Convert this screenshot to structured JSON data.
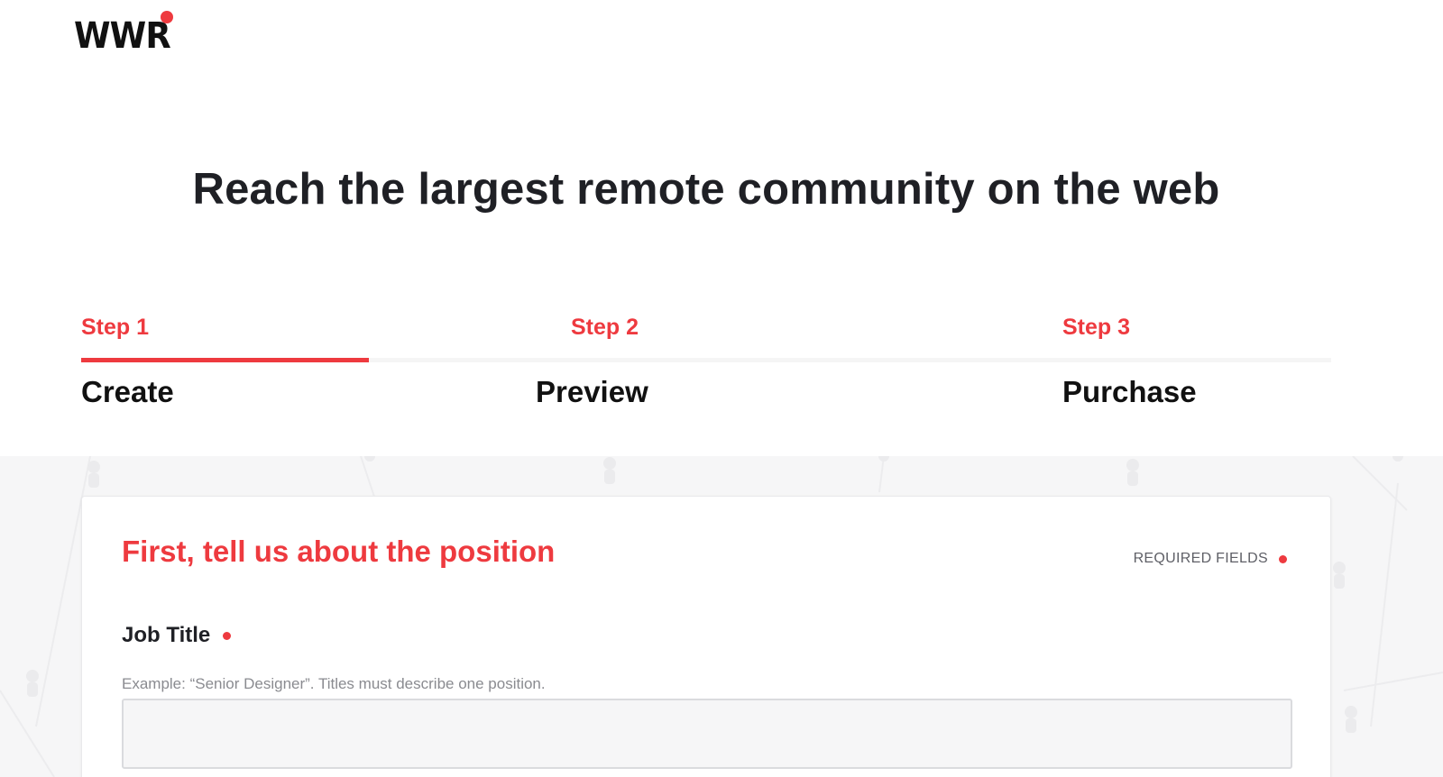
{
  "brand": {
    "logo_text": "WWR",
    "accent": "#ee3a3f"
  },
  "hero": {
    "title": "Reach the largest remote community on the web"
  },
  "steps": [
    {
      "label": "Step 1",
      "name": "Create",
      "active": true
    },
    {
      "label": "Step 2",
      "name": "Preview",
      "active": false
    },
    {
      "label": "Step 3",
      "name": "Purchase",
      "active": false
    }
  ],
  "progress": {
    "fraction": 0.23
  },
  "form": {
    "section_title": "First, tell us about the position",
    "required_note": "REQUIRED FIELDS",
    "job_title": {
      "label": "Job Title",
      "help": "Example: “Senior Designer”.  Titles must describe one position.",
      "value": "",
      "placeholder": ""
    }
  }
}
